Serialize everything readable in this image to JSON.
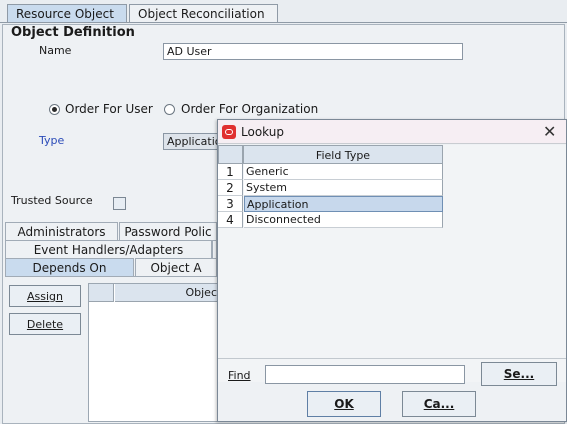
{
  "top_tabs": [
    {
      "label": "Resource Object",
      "active": true
    },
    {
      "label": "Object Reconciliation",
      "active": false
    }
  ],
  "object_definition": {
    "title": "Object Definition",
    "name_label": "Name",
    "name_value": "AD User",
    "radio_user": "Order For User",
    "radio_org": "Order For Organization",
    "type_label": "Type",
    "type_value": "Applicatio",
    "trusted_label": "Trusted Source"
  },
  "sub_tabs": {
    "row1": [
      "Administrators",
      "Password Polic"
    ],
    "row2": [
      "Event Handlers/Adapters"
    ],
    "row3": [
      {
        "label": "Depends On",
        "active": true
      },
      {
        "label": "Object A",
        "active": false
      }
    ]
  },
  "depends_on": {
    "assign_label": "Assign",
    "delete_label": "Delete",
    "column_header": "Objec"
  },
  "dialog": {
    "title": "Lookup",
    "column_header": "Field Type",
    "rows": [
      {
        "num": "1",
        "value": "Generic"
      },
      {
        "num": "2",
        "value": "System"
      },
      {
        "num": "3",
        "value": "Application",
        "selected": true
      },
      {
        "num": "4",
        "value": "Disconnected"
      }
    ],
    "find_label": "Find",
    "find_value": "",
    "search_label": "Se...",
    "ok_label": "OK",
    "cancel_label": "Ca..."
  },
  "colors": {
    "accent": "#c9dbee",
    "oracle_red": "#e03030",
    "type_label": "#2b4bb8"
  }
}
